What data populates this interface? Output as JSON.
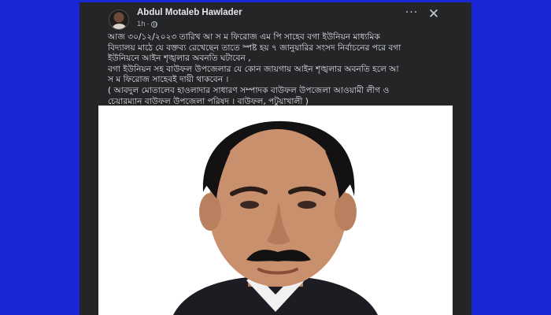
{
  "post": {
    "author_name": "Abdul Motaleb Hawlader",
    "timestamp": "1h",
    "audience_icon": "globe-icon",
    "body_lines": [
      "আজ ৩০/১২/২০২৩ তারিখ আ স ম ফিরোজ এম পি সাহেব বগা ইউনিয়ন মাধ্যমিক",
      "বিদ্যালয় মাঠে যে বক্তব্য রেখেছেন তাতে স্পষ্ট হয় ৭ জানুয়ারির সংসদ নির্বাচনের পরে বগা",
      "ইউনিয়নে আইন শৃঙ্খলার অবনতি ঘটাবেন ,",
      "বগা ইউনিয়ন সহ বাউফল উপজেলার যে কোন জায়গায় আইন শৃঙ্খলার অবনতি হলে আ",
      "স ম ফিরোজ সাহেবই দায়ী থাকবেন ।",
      "( আবদুল মোতালেব হাওলাদার সাধারণ সম্পাদক বাউফল উপজেলা আওয়ামী লীগ ও",
      "চেয়ারম্যান বাউফল উপজেলা পরিষদ । বাউফল, পটুয়াখালী )"
    ]
  },
  "header_icons": {
    "more": "···",
    "close": "✕"
  },
  "colors": {
    "background": "#1a27d6",
    "card": "#242526",
    "text": "#e4e6eb",
    "meta_text": "#a8abaf"
  }
}
